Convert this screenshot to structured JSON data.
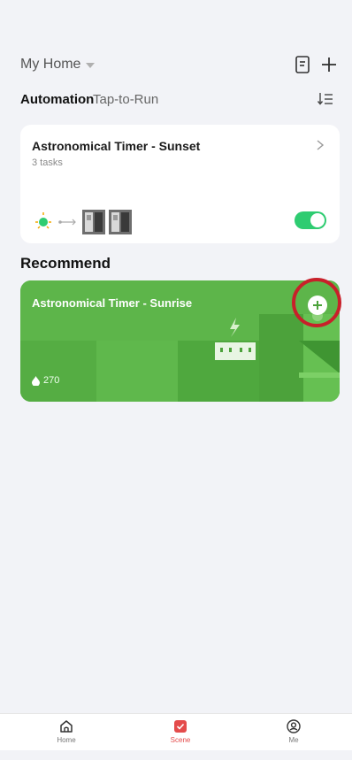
{
  "header": {
    "home_title": "My Home",
    "icons": [
      "edit-list-icon",
      "plus-icon"
    ]
  },
  "tabs": {
    "automation": "Automation",
    "tap_to_run": "Tap-to-Run",
    "sort_icon": "sort-icon"
  },
  "automation_card": {
    "title": "Astronomical Timer - Sunset",
    "subtitle": "3 tasks",
    "toggle_on": true,
    "icons": [
      "sun-icon",
      "arrow-icon",
      "device-icon",
      "device-icon"
    ]
  },
  "recommend": {
    "section_title": "Recommend",
    "card": {
      "title": "Astronomical Timer - Sunrise",
      "count": "270",
      "count_icon": "drop-icon",
      "add_icon": "plus-circle-icon"
    }
  },
  "bottom_nav": {
    "items": [
      {
        "label": "Home",
        "icon": "home-icon"
      },
      {
        "label": "Scene",
        "icon": "scene-check-icon"
      },
      {
        "label": "Me",
        "icon": "profile-icon"
      }
    ],
    "active_index": 1
  },
  "colors": {
    "accent_green": "#2ecc71",
    "card_green": "#5db54a",
    "active_red": "#e44b4b",
    "highlight_red": "#c8202a"
  }
}
